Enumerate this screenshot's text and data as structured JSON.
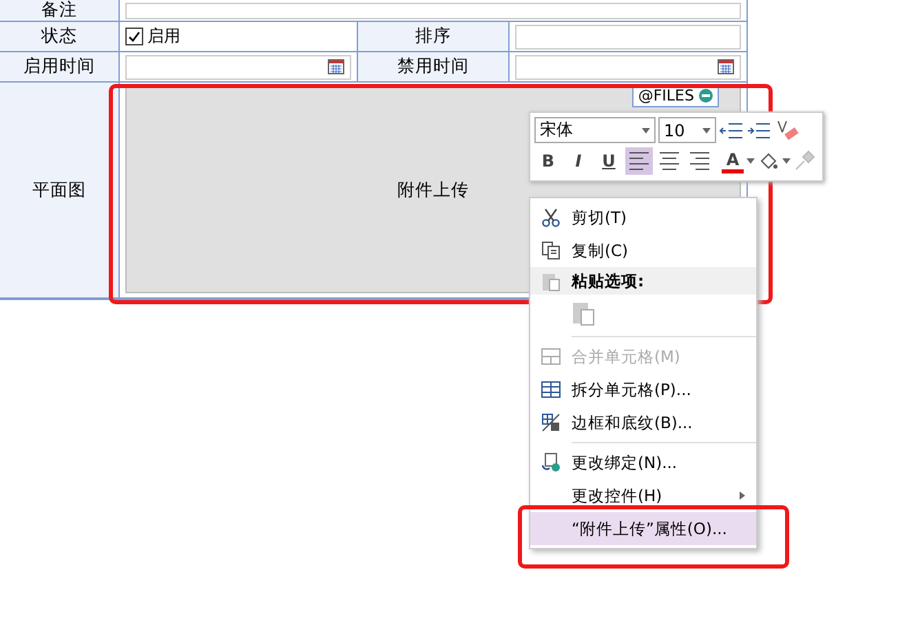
{
  "form": {
    "rows": [
      {
        "kind": "wide",
        "label": "备注"
      },
      {
        "kind": "pair",
        "label": "状态",
        "checkbox": {
          "label": "启用",
          "checked": true
        },
        "label2": "排序"
      },
      {
        "kind": "dates",
        "label": "启用时间",
        "label2": "禁用时间"
      },
      {
        "kind": "upload",
        "label": "平面图",
        "control_label": "附件上传",
        "tag": "@FILES"
      }
    ]
  },
  "mini_toolbar": {
    "font": "宋体",
    "size": "10",
    "bold": "B",
    "italic": "I",
    "underline": "U",
    "font_color": "A",
    "align": [
      {
        "selected": true
      },
      {
        "selected": false
      },
      {
        "selected": false
      }
    ]
  },
  "context_menu": {
    "items": [
      {
        "kind": "item",
        "label": "剪切(T)",
        "disabled": false,
        "selected": false
      },
      {
        "kind": "item",
        "label": "复制(C)",
        "disabled": false,
        "selected": false
      },
      {
        "kind": "header",
        "label": "粘贴选项:"
      },
      {
        "kind": "paste"
      },
      {
        "kind": "sep"
      },
      {
        "kind": "item",
        "label": "合并单元格(M)",
        "disabled": true,
        "selected": false
      },
      {
        "kind": "item",
        "label": "拆分单元格(P)...",
        "disabled": false,
        "selected": false
      },
      {
        "kind": "item",
        "label": "边框和底纹(B)...",
        "disabled": false,
        "selected": false
      },
      {
        "kind": "sep"
      },
      {
        "kind": "item",
        "label": "更改绑定(N)...",
        "disabled": false,
        "selected": false
      },
      {
        "kind": "submenu",
        "label": "更改控件(H)",
        "disabled": false,
        "selected": false
      },
      {
        "kind": "item",
        "label": "“附件上传”属性(O)...",
        "disabled": false,
        "selected": true
      }
    ]
  }
}
